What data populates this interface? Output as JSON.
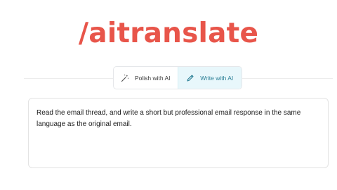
{
  "brand": {
    "logo_text": "/aitranslate",
    "color": "#e8554a"
  },
  "tabs": [
    {
      "label": "Polish with AI",
      "icon": "magic-wand-icon",
      "active": false
    },
    {
      "label": "Write with AI",
      "icon": "pencil-icon",
      "active": true
    }
  ],
  "editor": {
    "text": "Read the email thread, and write a short but professional email response in the same language as the original email."
  },
  "colors": {
    "active_tab_bg": "#e8f7fb",
    "active_tab_text": "#2b7f96"
  }
}
